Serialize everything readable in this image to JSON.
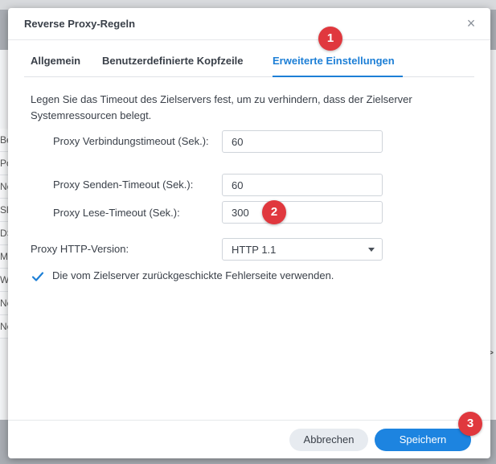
{
  "dialog": {
    "title": "Reverse Proxy-Regeln",
    "close_symbol": "×"
  },
  "tabs": [
    {
      "label": "Allgemein",
      "active": false
    },
    {
      "label": "Benutzerdefinierte Kopfzeile",
      "active": false
    },
    {
      "label": "Erweiterte Einstellungen",
      "active": true
    }
  ],
  "description": "Legen Sie das Timeout des Zielservers fest, um zu verhindern, dass der Zielserver Systemressourcen belegt.",
  "fields": {
    "connect_timeout": {
      "label": "Proxy Verbindungstimeout (Sek.):",
      "value": "60"
    },
    "send_timeout": {
      "label": "Proxy Senden-Timeout (Sek.):",
      "value": "60"
    },
    "read_timeout": {
      "label": "Proxy Lese-Timeout (Sek.):",
      "value": "300"
    },
    "http_version": {
      "label": "Proxy HTTP-Version:",
      "value": "HTTP 1.1"
    }
  },
  "checkbox": {
    "label": "Die vom Zielserver zurückgeschickte Fehlerseite verwenden.",
    "checked": true
  },
  "footer": {
    "cancel_label": "Abbrechen",
    "save_label": "Speichern"
  },
  "markers": [
    "1",
    "2",
    "3"
  ],
  "background_rows": [
    "Be",
    "Po",
    "Ne",
    "Sl",
    "DS",
    "M",
    "W",
    "Ne",
    "Ne"
  ],
  "background_right_glyph": ">",
  "colors": {
    "accent": "#1d7fd6",
    "save_button": "#1d84e0",
    "marker": "#e0383e"
  }
}
